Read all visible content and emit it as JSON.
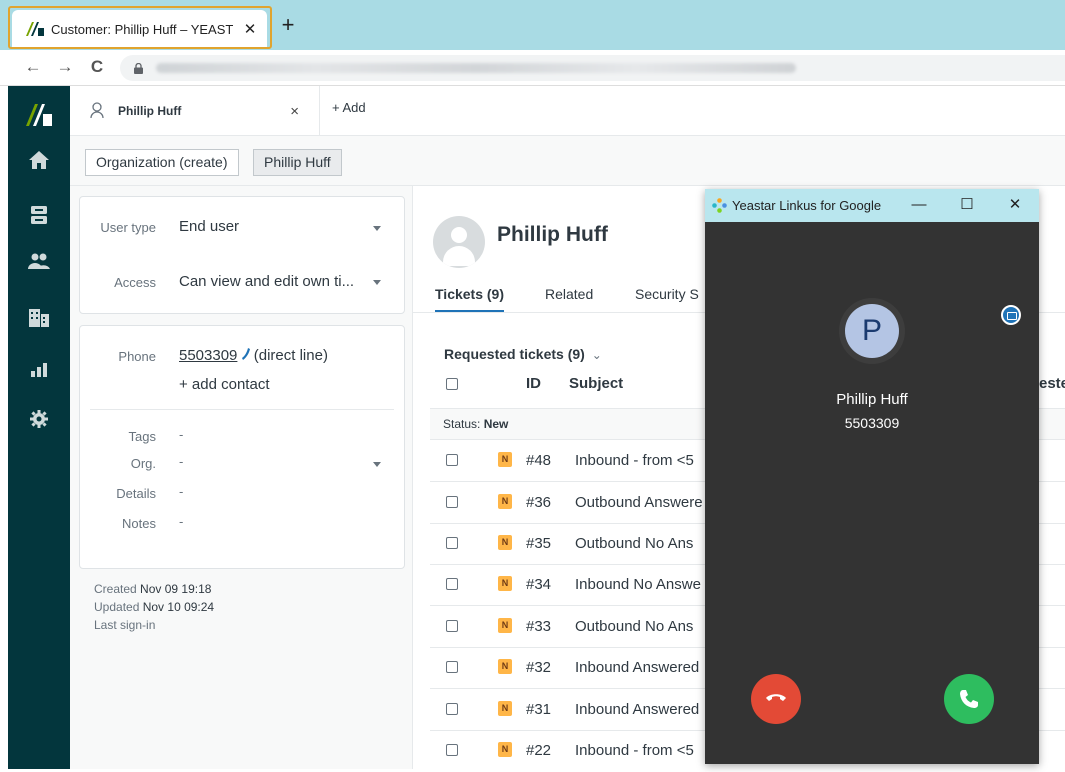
{
  "browser": {
    "tab_title": "Customer: Phillip Huff – YEAST",
    "tab_close": "✕",
    "new_tab": "+",
    "back": "←",
    "forward": "→",
    "reload": "C"
  },
  "topbar": {
    "workspace_tab_name": "Phillip Huff",
    "workspace_tab_close": "×",
    "add_label": "+ Add"
  },
  "breadcrumbs": [
    "Organization (create)",
    "Phillip Huff"
  ],
  "user_fields": {
    "user_type_label": "User type",
    "user_type_value": "End user",
    "access_label": "Access",
    "access_value": "Can view and edit own ti...",
    "phone_label": "Phone",
    "phone_value": "5503309",
    "phone_suffix": "(direct line)",
    "add_contact": "+ add contact",
    "tags_label": "Tags",
    "tags_value": "-",
    "org_label": "Org.",
    "org_value": "-",
    "details_label": "Details",
    "details_value": "-",
    "notes_label": "Notes",
    "notes_value": "-"
  },
  "meta": {
    "created_label": "Created",
    "created_value": "Nov 09 19:18",
    "updated_label": "Updated",
    "updated_value": "Nov 10 09:24",
    "last_signin_label": "Last sign-in"
  },
  "profile": {
    "name": "Phillip Huff",
    "tabs": [
      "Tickets (9)",
      "Related",
      "Security S"
    ]
  },
  "tickets": {
    "section_title": "Requested tickets (9)",
    "chevron": "⌄",
    "columns": [
      "ID",
      "Subject"
    ],
    "cut_column": "este",
    "group_label": "Status:",
    "group_value": "New",
    "rows": [
      {
        "status": "N",
        "id": "#48",
        "subject": "Inbound - from <5"
      },
      {
        "status": "N",
        "id": "#36",
        "subject": "Outbound Answere"
      },
      {
        "status": "N",
        "id": "#35",
        "subject": "Outbound No Ans"
      },
      {
        "status": "N",
        "id": "#34",
        "subject": "Inbound No Answe"
      },
      {
        "status": "N",
        "id": "#33",
        "subject": "Outbound No Ans"
      },
      {
        "status": "N",
        "id": "#32",
        "subject": "Inbound Answered"
      },
      {
        "status": "N",
        "id": "#31",
        "subject": "Inbound Answered"
      },
      {
        "status": "N",
        "id": "#22",
        "subject": "Inbound - from <5"
      }
    ]
  },
  "popup": {
    "title": "Yeastar Linkus for Google",
    "minimize": "—",
    "maximize": "☐",
    "close": "✕",
    "caller_initial": "P",
    "caller_name": "Phillip Huff",
    "caller_number": "5503309"
  },
  "colors": {
    "sidebar": "#03363d",
    "chrome_tabbar": "#a9dbe4",
    "tab_highlight": "#e0a42e",
    "popup_bg": "#333333",
    "popup_titlebar": "#b9e6ee",
    "hangup": "#e34a36",
    "answer": "#2ebd5f",
    "status_new": "#ffb648",
    "active_tab_underline": "#1f73b7"
  }
}
